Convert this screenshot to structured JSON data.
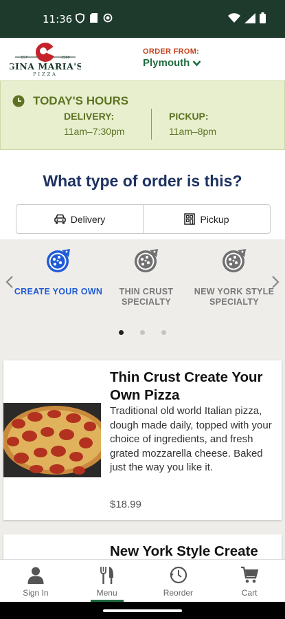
{
  "status_bar": {
    "time": "11:36"
  },
  "header": {
    "logo_text": "GINA MARIA'S",
    "logo_subtext": "PIZZA",
    "order_from_label": "ORDER FROM:",
    "location": "Plymouth"
  },
  "hours": {
    "title": "TODAY'S HOURS",
    "delivery_label": "DELIVERY:",
    "delivery_hours": "11am–7:30pm",
    "pickup_label": "PICKUP:",
    "pickup_hours": "11am–8pm"
  },
  "order_type": {
    "question": "What type of order is this?",
    "delivery_label": "Delivery",
    "pickup_label": "Pickup"
  },
  "categories": [
    {
      "label": "CREATE YOUR OWN",
      "active": true
    },
    {
      "label": "THIN CRUST SPECIALTY",
      "active": false
    },
    {
      "label": "NEW YORK STYLE SPECIALTY",
      "active": false
    }
  ],
  "pager": {
    "pages": 3,
    "current": 1
  },
  "products": [
    {
      "name": "Thin Crust Create Your Own Pizza",
      "description": "Traditional old world Italian pizza, dough made daily, topped with your choice of ingredients, and fresh grated mozzarella cheese. Baked just the way you like it.",
      "price": "$18.99"
    },
    {
      "name": "New York Style Create"
    }
  ],
  "tabs": [
    {
      "label": "Sign In",
      "icon": "person-icon"
    },
    {
      "label": "Menu",
      "icon": "fork-knife-icon"
    },
    {
      "label": "Reorder",
      "icon": "reorder-clock-icon"
    },
    {
      "label": "Cart",
      "icon": "cart-icon"
    }
  ],
  "colors": {
    "status_bar": "#1d3a2c",
    "brand_green": "#1f6b3f",
    "order_from_red": "#c2421d",
    "hours_bg": "#e8efcf",
    "hours_text": "#5d7322",
    "question_navy": "#1e3361",
    "active_blue": "#1f5bd6"
  }
}
